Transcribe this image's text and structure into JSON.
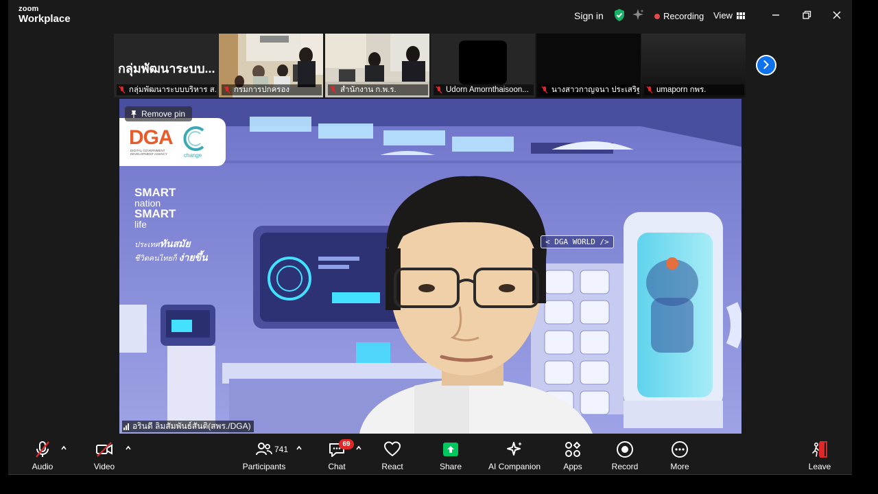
{
  "window": {
    "brand_small": "zoom",
    "brand_name": "Workplace",
    "sign_in": "Sign in",
    "recording": "Recording",
    "view": "View"
  },
  "strip": {
    "big_name": "กลุ่มพัฒนาระบบ...",
    "tiles": [
      {
        "label": "กลุ่มพัฒนาระบบบริหาร ส..."
      },
      {
        "label": "กรมการปกครอง"
      },
      {
        "label": "สำนักงาน ก.พ.ร."
      },
      {
        "label": "Udorn Amornthaisoon..."
      },
      {
        "label": "นางสาวกาญจนา ประเสริฐ ..."
      },
      {
        "label": "umaporn กพร."
      }
    ]
  },
  "main": {
    "pin": "Remove pin",
    "speaker": "อรินดี ลิมสัมพันธ์สันติ(สพร./DGA)",
    "background": {
      "logo": "DGA",
      "logo_sub": "DIGITAL GOVERNMENT DEVELOPMENT AGENCY",
      "change": "change",
      "smart1": "SMART",
      "nation": "nation",
      "smart2": "SMART",
      "life": "life",
      "thai1_pre": "ประเทศ",
      "thai1_bold": "ทันสมัย",
      "thai2_pre": "ชีวิตคนไทยก็",
      "thai2_bold": "ง่ายขึ้น",
      "world": "< DGA WORLD />"
    }
  },
  "toolbar": {
    "audio": "Audio",
    "video": "Video",
    "participants": "Participants",
    "participant_count": "741",
    "chat": "Chat",
    "chat_badge": "69",
    "react": "React",
    "share": "Share",
    "ai": "AI Companion",
    "apps": "Apps",
    "record": "Record",
    "more": "More",
    "leave": "Leave"
  },
  "colors": {
    "accent": "#0e72ed",
    "share": "#00c65e",
    "danger": "#e02828",
    "shield": "#16b364",
    "logo_orange": "#e85b2b",
    "teal": "#3aa9b5"
  }
}
